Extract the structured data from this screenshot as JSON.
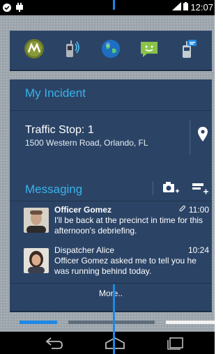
{
  "status": {
    "time": "12:07"
  },
  "apps": [
    {
      "name": "motorola",
      "icon": "motorola-icon"
    },
    {
      "name": "radio",
      "icon": "radio-phone-icon"
    },
    {
      "name": "globe",
      "icon": "globe-icon"
    },
    {
      "name": "messaging",
      "icon": "chat-icon"
    },
    {
      "name": "device",
      "icon": "handheld-icon"
    }
  ],
  "incident": {
    "title": "My Incident",
    "name": "Traffic Stop: 1",
    "address": "1500 Western Road, Orlando, FL"
  },
  "messaging": {
    "title": "Messaging",
    "messages": [
      {
        "sender": "Officer Gomez",
        "time": "11:00",
        "text": "I'll be back at the precinct in time for this afternoon's debriefing."
      },
      {
        "sender": "Dispatcher Alice",
        "time": "10:24",
        "text": "Officer Gomez asked me to tell you he was running behind today."
      }
    ],
    "more": "More.."
  },
  "colors": {
    "accent": "#39b3ea",
    "card": "#2b4466",
    "active_page": "#1e88e5"
  }
}
